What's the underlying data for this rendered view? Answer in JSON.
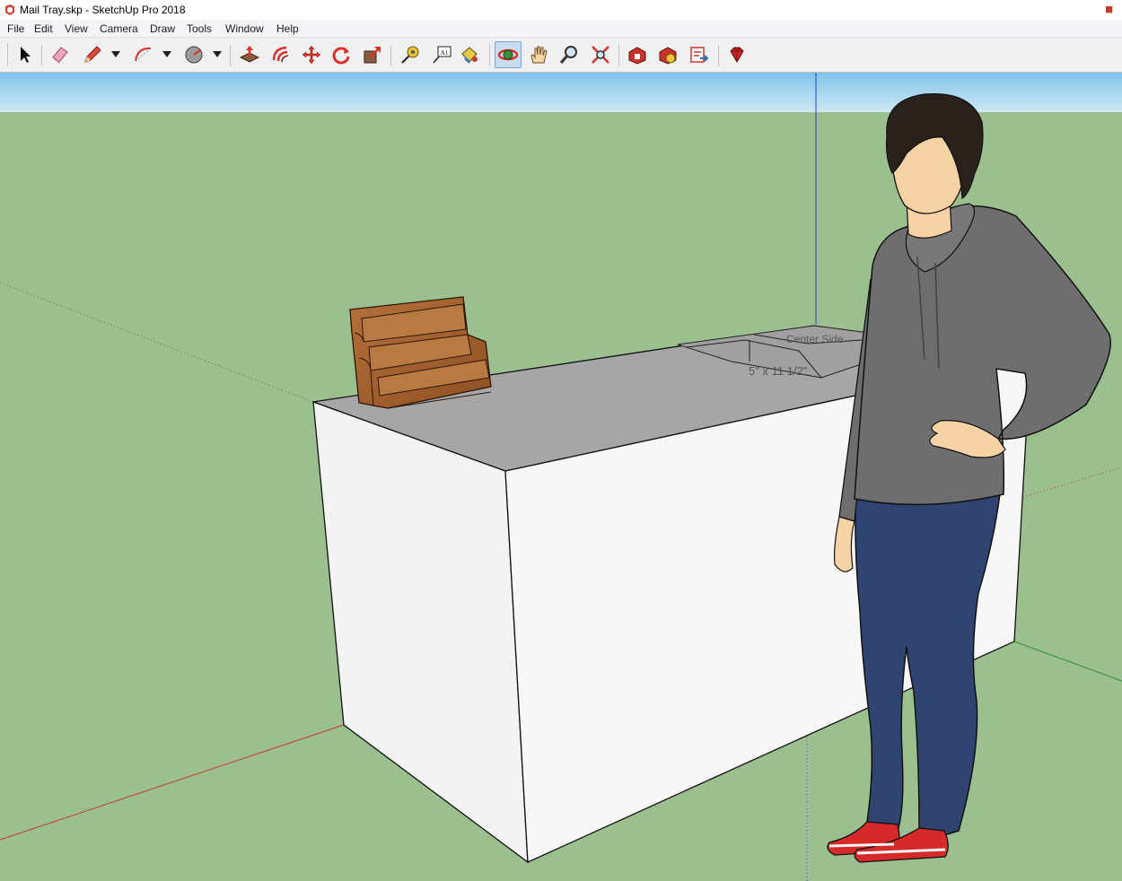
{
  "window": {
    "title": "Mail Tray.skp - SketchUp Pro 2018"
  },
  "menu": [
    "File",
    "Edit",
    "View",
    "Camera",
    "Draw",
    "Tools",
    "Window",
    "Help"
  ],
  "toolbar": {
    "tools": [
      {
        "name": "select-tool",
        "icon": "arrow-icon"
      },
      {
        "name": "eraser-tool",
        "icon": "eraser-icon"
      },
      {
        "name": "pencil-tool",
        "icon": "pencil-icon"
      },
      {
        "name": "arc-tool",
        "icon": "arc-icon"
      },
      {
        "name": "shapes-tool",
        "icon": "circle-icon"
      },
      {
        "name": "push-pull-tool",
        "icon": "push-pull-icon"
      },
      {
        "name": "offset-tool",
        "icon": "offset-icon"
      },
      {
        "name": "move-tool",
        "icon": "move-icon"
      },
      {
        "name": "rotate-tool",
        "icon": "rotate-icon"
      },
      {
        "name": "scale-tool",
        "icon": "scale-icon"
      },
      {
        "name": "tape-measure-tool",
        "icon": "tape-measure-icon"
      },
      {
        "name": "text-tool",
        "icon": "text-icon"
      },
      {
        "name": "paint-bucket-tool",
        "icon": "paint-bucket-icon"
      },
      {
        "name": "orbit-tool",
        "icon": "orbit-icon",
        "active": true
      },
      {
        "name": "pan-tool",
        "icon": "hand-icon"
      },
      {
        "name": "zoom-tool",
        "icon": "magnifier-icon"
      },
      {
        "name": "zoom-extents-tool",
        "icon": "zoom-extents-icon"
      },
      {
        "name": "warehouse-tool",
        "icon": "warehouse-icon"
      },
      {
        "name": "extension-warehouse-tool",
        "icon": "extension-icon"
      },
      {
        "name": "send-to-layout-tool",
        "icon": "layout-icon"
      },
      {
        "name": "ruby-console-tool",
        "icon": "ruby-icon"
      }
    ],
    "text_tool_glyph": "A1"
  },
  "scene": {
    "dimension_label": "5\" x 11 1/2\"",
    "part_label": "Center Side"
  },
  "colors": {
    "sky": "#a9d7f0",
    "ground": "#9cbf8f",
    "box_front": "#f6f6f6",
    "box_side": "#ececec",
    "box_top": "#a6a6a6",
    "wood": "#a6622c",
    "hoodie": "#6e6e6e",
    "jeans": "#2f4470",
    "skin": "#f6d2a4",
    "hair": "#2b211c",
    "shoes": "#d62a2a",
    "axis_red": "#c23b2b",
    "axis_green": "#2a8f2a",
    "axis_blue": "#2b3fc9"
  }
}
